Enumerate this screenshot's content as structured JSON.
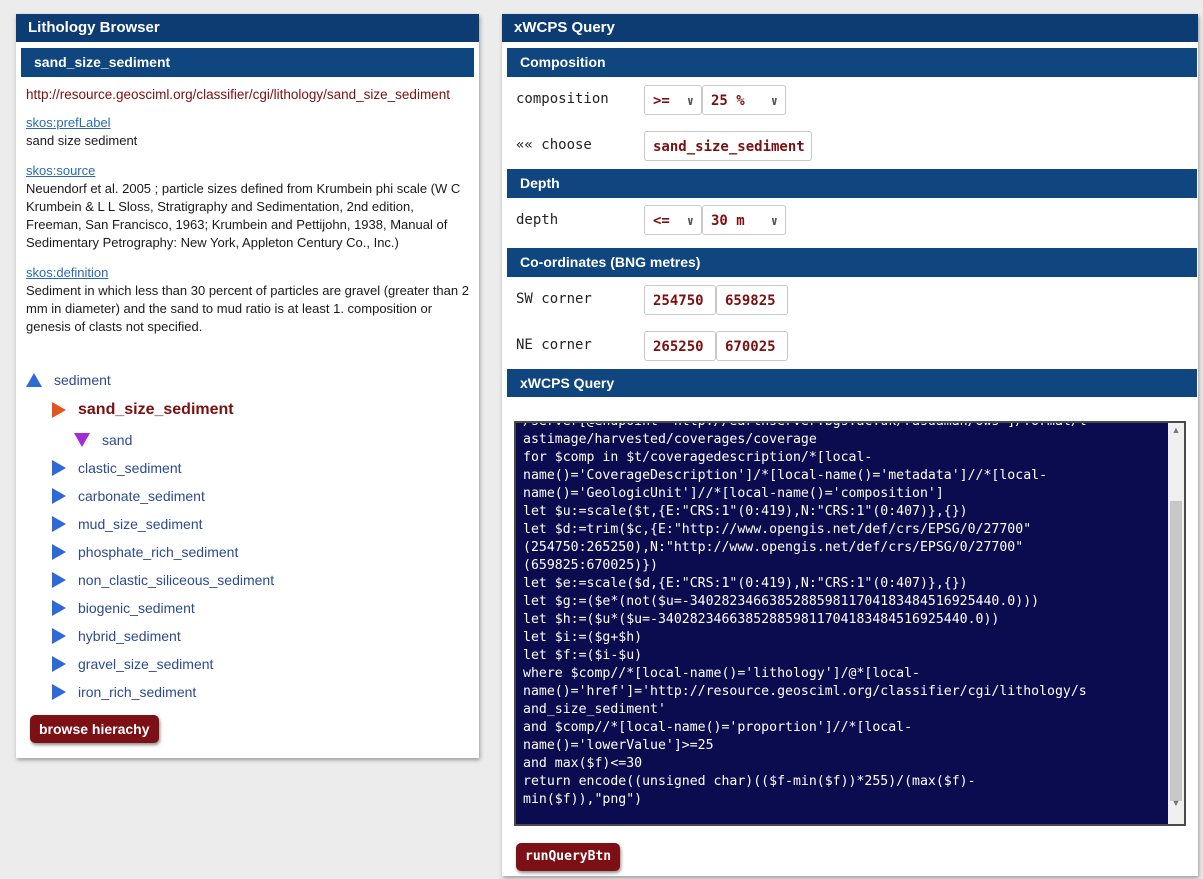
{
  "lithology": {
    "title": "Lithology Browser",
    "selected_name": "sand_size_sediment",
    "uri": "http://resource.geosciml.org/classifier/cgi/lithology/sand_size_sediment",
    "pref_label_key": "skos:prefLabel",
    "pref_label_value": "sand size sediment",
    "source_key": "skos:source",
    "source_value": "Neuendorf et al. 2005 ; particle sizes defined from Krumbein phi scale (W C Krumbein & L L Sloss, Stratigraphy and Sedimentation, 2nd edition, Freeman, San Francisco, 1963; Krumbein and Pettijohn, 1938, Manual of Sedimentary Petrography: New York, Appleton Century Co., Inc.)",
    "definition_key": "skos:definition",
    "definition_value": "Sediment in which less than 30 percent of particles are gravel (greater than 2 mm in diameter) and the sand to mud ratio is at least 1. composition or genesis of clasts not specified.",
    "tree": {
      "parent": "sediment",
      "selected": "sand_size_sediment",
      "child": "sand",
      "siblings": [
        "clastic_sediment",
        "carbonate_sediment",
        "mud_size_sediment",
        "phosphate_rich_sediment",
        "non_clastic_siliceous_sediment",
        "biogenic_sediment",
        "hybrid_sediment",
        "gravel_size_sediment",
        "iron_rich_sediment"
      ]
    },
    "browse_button": "browse hierachy"
  },
  "query": {
    "title": "xWCPS Query",
    "composition_section": "Composition",
    "composition_label": "composition",
    "composition_op": ">=",
    "composition_value": "25 %",
    "choose_label": "«« choose",
    "choose_value": "sand_size_sediment",
    "depth_section": "Depth",
    "depth_label": "depth",
    "depth_op": "<=",
    "depth_value": "30 m",
    "coords_section": "Co-ordinates (BNG metres)",
    "sw_label": "SW corner",
    "sw_x": "254750",
    "sw_y": "659825",
    "ne_label": "NE corner",
    "ne_x": "265250",
    "ne_y": "670025",
    "xwcps_section": "xWCPS Query",
    "code": "/server[@endpoint='http://earthserver.bgs.ac.uk/rasdaman/ows']/formal/l\nastimage/harvested/coverages/coverage\nfor $comp in $t/coveragedescription/*[local-\nname()='CoverageDescription']/*[local-name()='metadata']//*[local-\nname()='GeologicUnit']//*[local-name()='composition']\nlet $u:=scale($t,{E:\"CRS:1\"(0:419),N:\"CRS:1\"(0:407)},{})\nlet $d:=trim($c,{E:\"http://www.opengis.net/def/crs/EPSG/0/27700\"\n(254750:265250),N:\"http://www.opengis.net/def/crs/EPSG/0/27700\"\n(659825:670025)})\nlet $e:=scale($d,{E:\"CRS:1\"(0:419),N:\"CRS:1\"(0:407)},{})\nlet $g:=($e*(not($u=-340282346638528859811704183484516925440.0)))\nlet $h:=($u*($u=-340282346638528859811704183484516925440.0))\nlet $i:=($g+$h)\nlet $f:=($i-$u)\nwhere $comp//*[local-name()='lithology']/@*[local-\nname()='href']='http://resource.geosciml.org/classifier/cgi/lithology/s\nand_size_sediment'\nand $comp//*[local-name()='proportion']//*[local-\nname()='lowerValue']>=25\nand max($f)<=30\nreturn encode((unsigned char)(($f-min($f))*255)/(max($f)-\nmin($f)),\"png\")",
    "run_button": "runQueryBtn"
  },
  "colors": {
    "header_blue": "#0d3c73",
    "section_blue": "#10467f",
    "button_red": "#7c1015",
    "code_bg": "#0b0b4f",
    "selected_arrow": "#e3541e"
  }
}
